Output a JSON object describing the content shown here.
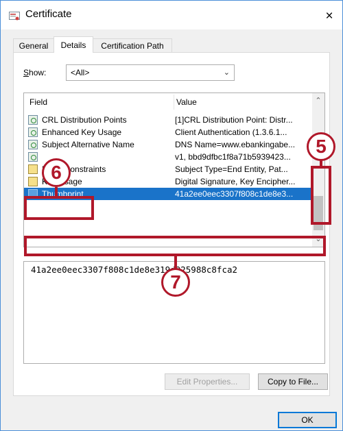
{
  "window": {
    "title": "Certificate",
    "close_symbol": "×"
  },
  "tabs": [
    {
      "label": "General"
    },
    {
      "label": "Details"
    },
    {
      "label": "Certification Path"
    }
  ],
  "show": {
    "label": "Show:",
    "value": "<All>",
    "chevron": "⌄"
  },
  "list": {
    "columns": {
      "field": "Field",
      "value": "Value"
    },
    "rows": [
      {
        "field": "CRL Distribution Points",
        "value": "[1]CRL Distribution Point: Distr..."
      },
      {
        "field": "Enhanced Key Usage",
        "value": "Client Authentication (1.3.6.1..."
      },
      {
        "field": "Subject Alternative Name",
        "value": "DNS Name=www.ebankingabe..."
      },
      {
        "field": "",
        "value": "v1, bbd9dfbc1f8a71b5939423..."
      },
      {
        "field": "Basic Constraints",
        "value": "Subject Type=End Entity, Pat..."
      },
      {
        "field": "Key Usage",
        "value": "Digital Signature, Key Encipher..."
      },
      {
        "field": "Thumbprint",
        "value": "41a2ee0eec3307f808c1de8e3..."
      }
    ],
    "selected_index": 6,
    "scroll_up": "⌃",
    "scroll_down": "⌄"
  },
  "detail": {
    "text": "41a2ee0eec3307f808c1de8e319d925988c8fca2"
  },
  "buttons": {
    "edit": "Edit Properties...",
    "copy": "Copy to File...",
    "ok": "OK"
  },
  "annotations": {
    "five": "5",
    "six": "6",
    "seven": "7",
    "color": "#b0182a"
  },
  "colors": {
    "selection": "#1a73c9",
    "window_border": "#4a8fd8"
  },
  "icons": [
    "certificate-icon",
    "close-icon",
    "chevron-down-icon",
    "cert-field-icon",
    "warning-field-icon",
    "thumbprint-field-icon"
  ]
}
